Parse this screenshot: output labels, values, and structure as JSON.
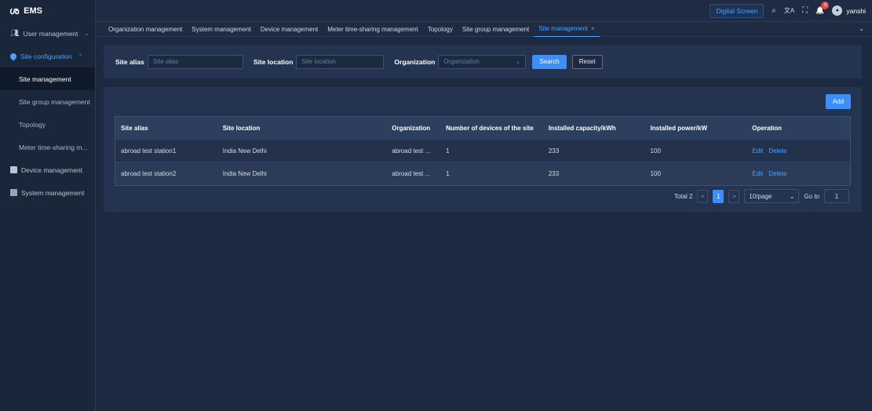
{
  "app": {
    "logo_mark": "ശ",
    "name": "EMS"
  },
  "sidebar": {
    "items": [
      {
        "label": "User management",
        "chevron": "⌄"
      },
      {
        "label": "Site configuration",
        "chevron": "⌃"
      },
      {
        "label": "Site management"
      },
      {
        "label": "Site group management"
      },
      {
        "label": "Topology"
      },
      {
        "label": "Meter time-sharing m..."
      },
      {
        "label": "Device management"
      },
      {
        "label": "System management"
      }
    ]
  },
  "topbar": {
    "digital_screen": "Digital Screen",
    "search_icon": "⌕",
    "translate_icon": "文A",
    "fullscreen_icon": "⛶",
    "bell_icon": "🔔",
    "notification_count": "3",
    "avatar_glyph": "●",
    "username": "yanshi"
  },
  "tabs": {
    "items": [
      "Organization management",
      "System management",
      "Device management",
      "Meter time-sharing management",
      "Topology",
      "Site group management",
      "Site management"
    ],
    "active_close": "×",
    "more": "⌄"
  },
  "filter": {
    "site_alias_label": "Site alias",
    "site_alias_placeholder": "Site alias",
    "site_location_label": "Site location",
    "site_location_placeholder": "Site location",
    "organization_label": "Organization",
    "organization_placeholder": "Organization",
    "dropdown_arrow": "⌄",
    "search": "Search",
    "reset": "Reset"
  },
  "table": {
    "add": "Add",
    "columns": [
      "Site alias",
      "Site location",
      "Organization",
      "Number of devices of the site",
      "Installed capacity/kWh",
      "Installed power/kW",
      "Operation"
    ],
    "rows": [
      {
        "alias": "abroad test station1",
        "location": "India New Delhi",
        "org": "abroad test ...",
        "devices": "1",
        "capacity": "233",
        "power": "100",
        "edit": "Edit",
        "delete": "Delete"
      },
      {
        "alias": "abroad test station2",
        "location": "India New Delhi",
        "org": "abroad test ...",
        "devices": "1",
        "capacity": "233",
        "power": "100",
        "edit": "Edit",
        "delete": "Delete"
      }
    ]
  },
  "pagination": {
    "total": "Total 2",
    "prev": "<",
    "page": "1",
    "next": ">",
    "page_size": "10/page",
    "size_arrow": "⌄",
    "goto_label": "Go to",
    "goto_value": "1"
  },
  "colors": {
    "accent": "#3e8ef7",
    "link": "#4aa3ff",
    "sidebar_bg": "#1a2639",
    "content_bg": "#1c2940",
    "panel_bg": "#243350",
    "badge": "#e5484d"
  }
}
